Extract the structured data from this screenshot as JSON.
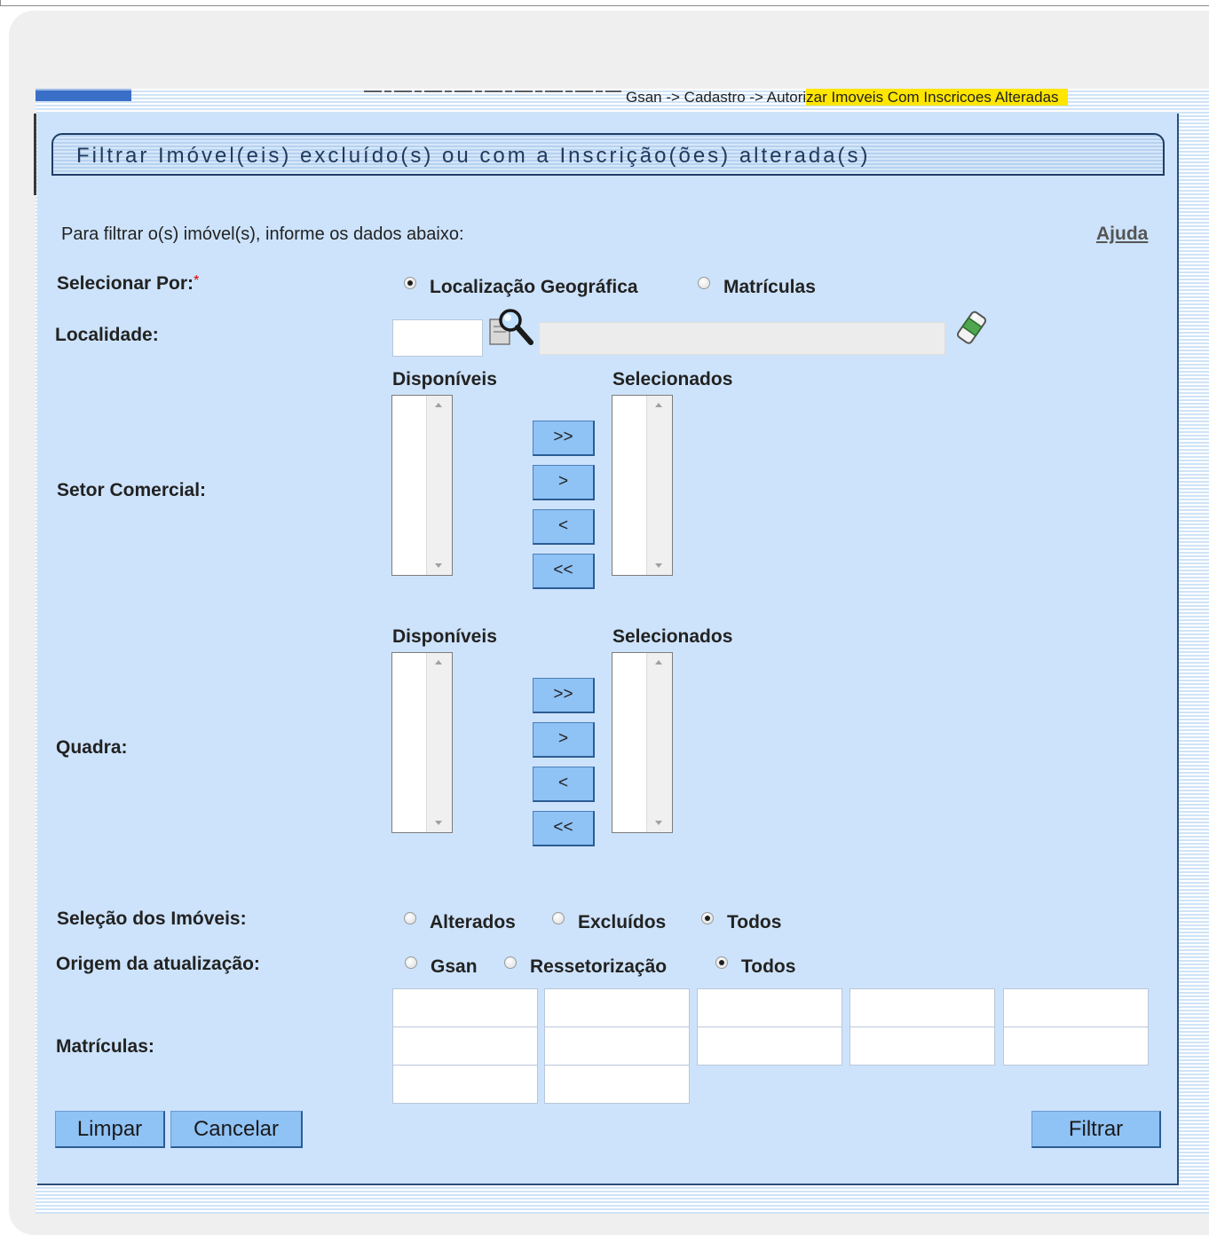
{
  "breadcrumb": {
    "prefix": "Gsan -> Cadastro -> Autori",
    "highlighted": "zar Imoveis Com Inscricoes Alteradas"
  },
  "page_title": "Filtrar Imóvel(eis) excluído(s) ou com a Inscrição(ões) alterada(s)",
  "instructions": "Para filtrar o(s) imóvel(s), informe os dados abaixo:",
  "help_link": "Ajuda",
  "selecionar_por": {
    "label": "Selecionar Por:",
    "required_mark": "*",
    "options": [
      "Localização Geográfica",
      "Matrículas"
    ],
    "selected": "Localização Geográfica"
  },
  "localidade": {
    "label": "Localidade:",
    "code_value": "",
    "description_value": "",
    "icons": [
      "search-icon",
      "eraser-icon"
    ]
  },
  "setor_comercial": {
    "label": "Setor Comercial:",
    "available_label": "Disponíveis",
    "selected_label": "Selecionados",
    "buttons": [
      ">>",
      ">",
      "<",
      "<<"
    ]
  },
  "quadra": {
    "label": "Quadra:",
    "available_label": "Disponíveis",
    "selected_label": "Selecionados",
    "buttons": [
      ">>",
      ">",
      "<",
      "<<"
    ]
  },
  "selecao_imoveis": {
    "label": "Seleção dos Imóveis:",
    "options": [
      "Alterados",
      "Excluídos",
      "Todos"
    ],
    "selected": "Todos"
  },
  "origem_atualizacao": {
    "label": "Origem da atualização:",
    "options": [
      "Gsan",
      "Ressetorização",
      "Todos"
    ],
    "selected": "Todos"
  },
  "matriculas": {
    "label": "Matrículas:",
    "values": [
      "",
      "",
      "",
      "",
      "",
      "",
      "",
      "",
      "",
      "",
      "",
      ""
    ]
  },
  "actions": {
    "limpar": "Limpar",
    "cancelar": "Cancelar",
    "filtrar": "Filtrar"
  },
  "colors": {
    "panel_background": "#cde3fb",
    "button_background": "#8fc2f5",
    "breadcrumb_highlight": "#ffe600",
    "title_text": "#213a5c"
  }
}
